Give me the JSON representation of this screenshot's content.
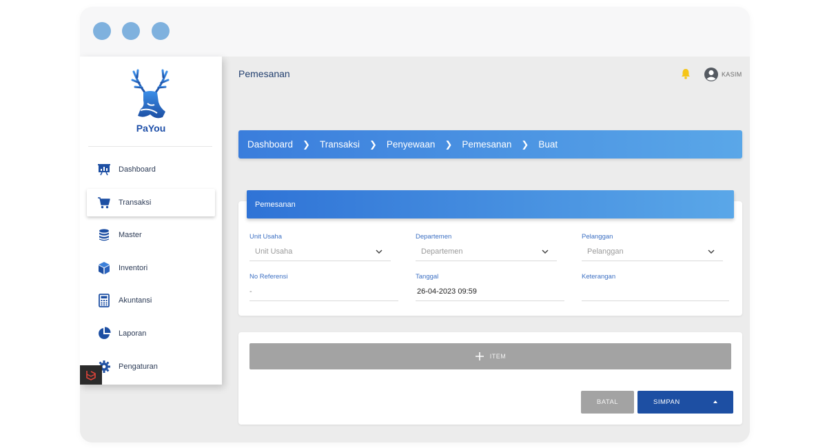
{
  "colors": {
    "window_dots": "#7fb1de",
    "accent_blue": "#3a7ddc",
    "primary_button": "#1d4fa3",
    "secondary_button": "#a3a3a3",
    "bell": "#f5c518"
  },
  "sidebar": {
    "brand": "PaYou",
    "items": [
      {
        "label": "Dashboard",
        "icon": "presentation-chart-icon",
        "active": false
      },
      {
        "label": "Transaksi",
        "icon": "shopping-cart-icon",
        "active": true
      },
      {
        "label": "Master",
        "icon": "database-icon",
        "active": false
      },
      {
        "label": "Inventori",
        "icon": "cube-icon",
        "active": false
      },
      {
        "label": "Akuntansi",
        "icon": "calculator-icon",
        "active": false
      },
      {
        "label": "Laporan",
        "icon": "pie-chart-icon",
        "active": false
      },
      {
        "label": "Pengaturan",
        "icon": "gear-icon",
        "active": false
      }
    ]
  },
  "header": {
    "title": "Pemesanan",
    "user": "KASIM"
  },
  "breadcrumb": [
    "Dashboard",
    "Transaksi",
    "Penyewaan",
    "Pemesanan",
    "Buat"
  ],
  "form": {
    "title": "Pemesanan",
    "fields": {
      "unit_usaha": {
        "label": "Unit Usaha",
        "value": "Unit Usaha"
      },
      "departemen": {
        "label": "Departemen",
        "value": "Departemen"
      },
      "pelanggan": {
        "label": "Pelanggan",
        "value": "Pelanggan"
      },
      "no_referensi": {
        "label": "No Referensi",
        "value": "-"
      },
      "tanggal": {
        "label": "Tanggal",
        "value": "26-04-2023 09:59"
      },
      "keterangan": {
        "label": "Keterangan",
        "value": ""
      }
    }
  },
  "actions": {
    "add_item": "ITEM",
    "cancel": "BATAL",
    "save": "SIMPAN"
  }
}
